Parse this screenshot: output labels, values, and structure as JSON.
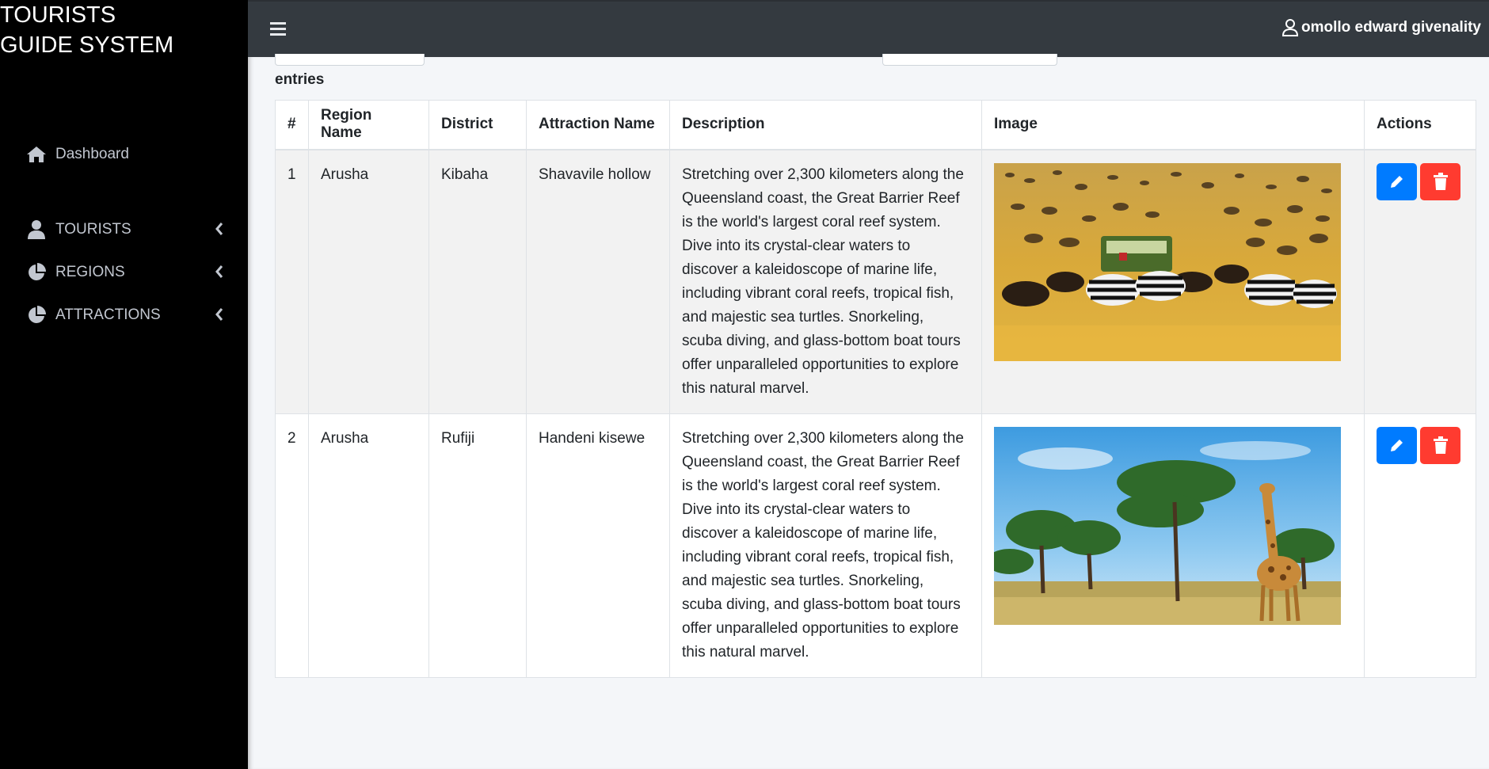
{
  "brand": {
    "line1": "TOURISTS",
    "line2": "GUIDE SYSTEM"
  },
  "sidebar": {
    "items": [
      {
        "label": "Dashboard",
        "icon": "home-icon"
      },
      {
        "label": "TOURISTS",
        "icon": "user-icon"
      },
      {
        "label": "REGIONS",
        "icon": "chart-pie-icon"
      },
      {
        "label": "ATTRACTIONS",
        "icon": "chart-pie-icon"
      }
    ]
  },
  "topbar": {
    "user_name": "omollo edward givenality",
    "menu_icon": "hamburger-icon"
  },
  "main": {
    "entries_label": "entries"
  },
  "table": {
    "headers": [
      "#",
      "Region Name",
      "District",
      "Attraction Name",
      "Description",
      "Image",
      "Actions"
    ],
    "rows": [
      {
        "num": "1",
        "region": "Arusha",
        "district": "Kibaha",
        "attraction": "Shavavile hollow",
        "description": "Stretching over 2,300 kilometers along the Queensland coast, the Great Barrier Reef is the world's largest coral reef system. Dive into its crystal-clear waters to discover a kaleidoscope of marine life, including vibrant coral reefs, tropical fish, and majestic sea turtles. Snorkeling, scuba diving, and glass-bottom boat tours offer unparalleled opportunities to explore this natural marvel.",
        "image": "safari-wildebeest-zebra-photo"
      },
      {
        "num": "2",
        "region": "Arusha",
        "district": "Rufiji",
        "attraction": "Handeni kisewe",
        "description": "Stretching over 2,300 kilometers along the Queensland coast, the Great Barrier Reef is the world's largest coral reef system. Dive into its crystal-clear waters to discover a kaleidoscope of marine life, including vibrant coral reefs, tropical fish, and majestic sea turtles. Snorkeling, scuba diving, and glass-bottom boat tours offer unparalleled opportunities to explore this natural marvel.",
        "image": "giraffe-acacia-savanna-photo"
      }
    ]
  },
  "colors": {
    "sidebar": "#000000",
    "topbar": "#343a40",
    "edit_button": "#007bff",
    "delete_button": "#ff3b30"
  }
}
